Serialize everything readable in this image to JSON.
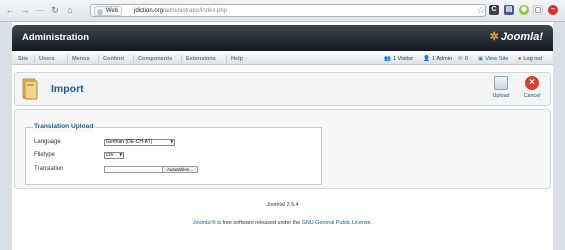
{
  "browser": {
    "scheme_label": "Web",
    "url_host": "jdiction.org",
    "url_path": "/administrator/index.php"
  },
  "header": {
    "title": "Administration",
    "logo_text": "Joomla!"
  },
  "menu": [
    "Site",
    "Users",
    "Menus",
    "Content",
    "Components",
    "Extensions",
    "Help"
  ],
  "status": {
    "visitors": "1 Visitor",
    "admins": "1 Admin",
    "messages": "0",
    "view_site": "View Site",
    "logout": "Log out"
  },
  "toolbar": {
    "title": "Import",
    "upload_label": "Upload",
    "cancel_label": "Cancel"
  },
  "form": {
    "legend": "Translation Upload",
    "language_label": "Language",
    "language_value": "German (DE-CH-AT)",
    "filetype_label": "Filetype",
    "filetype_value": "csv",
    "translation_label": "Translation",
    "browse_label": "Auswählen..."
  },
  "footer": {
    "version": "Joomla! 2.5.4",
    "brand": "Joomla!®",
    "text": " is free software released under the ",
    "license": "GNU General Public License",
    "dot": "."
  },
  "colors": {
    "accent": "#146295",
    "header_dark": "#151a20",
    "logo_orange": "#f0a12a"
  }
}
